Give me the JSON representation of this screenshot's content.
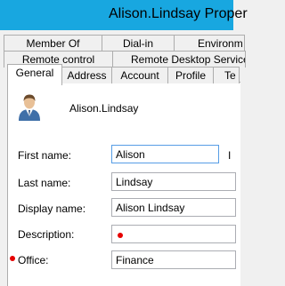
{
  "window": {
    "title": "Alison.Lindsay Proper"
  },
  "tabs": {
    "row1": [
      "Member Of",
      "Dial-in",
      "Environm"
    ],
    "row2": [
      "Remote control",
      "Remote Desktop Service"
    ],
    "row3": [
      "General",
      "Address",
      "Account",
      "Profile",
      "Te"
    ]
  },
  "general": {
    "user_name": "Alison.Lindsay",
    "first_name_label": "First name:",
    "first_name_value": "Alison",
    "initials_label_fragment": "I",
    "last_name_label": "Last name:",
    "last_name_value": "Lindsay",
    "display_name_label": "Display name:",
    "display_name_value": "Alison Lindsay",
    "description_label": "Description:",
    "description_value": "",
    "office_label": "Office:",
    "office_value": "Finance"
  },
  "colors": {
    "titlebar": "#18a7e0",
    "marker": "#e60000",
    "focus_border": "#569de5"
  },
  "icons": {
    "user_avatar": "user-icon"
  }
}
